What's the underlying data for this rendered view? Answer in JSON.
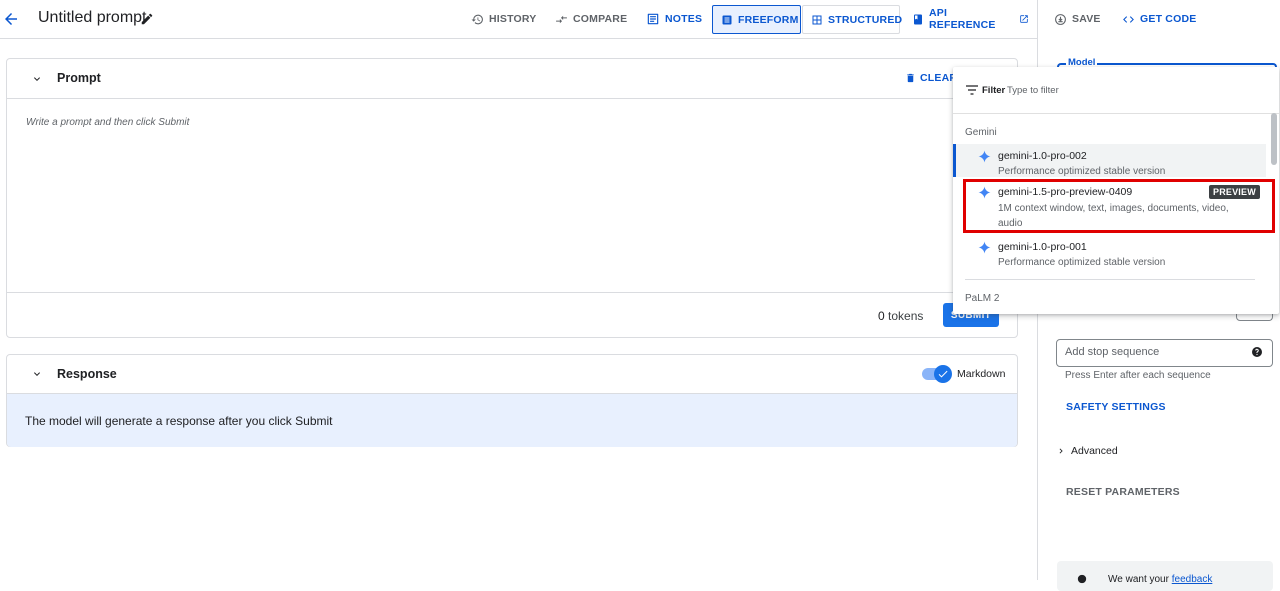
{
  "header": {
    "title": "Untitled prompt",
    "buttons": {
      "history": "HISTORY",
      "compare": "COMPARE",
      "notes": "NOTES",
      "freeform": "FREEFORM",
      "structured": "STRUCTURED",
      "api_reference": "API REFERENCE"
    }
  },
  "right_panel": {
    "save": "SAVE",
    "get_code": "GET CODE",
    "model_label": "Model",
    "stop_sequence_placeholder": "Add stop sequence",
    "stop_sequence_hint": "Press Enter after each sequence",
    "safety_settings": "SAFETY SETTINGS",
    "advanced": "Advanced",
    "reset_parameters": "RESET PARAMETERS",
    "feedback_prefix": "We want your ",
    "feedback_link": "feedback"
  },
  "prompt": {
    "title": "Prompt",
    "clear": "CLEAR",
    "placeholder": "Write a prompt and then click Submit",
    "tokens_count": "0",
    "tokens_label": "tokens",
    "submit": "SUBMIT"
  },
  "response": {
    "title": "Response",
    "markdown_label": "Markdown",
    "markdown_enabled": true,
    "placeholder": "The model will generate a response after you click Submit"
  },
  "model_dropdown": {
    "filter_label": "Filter",
    "filter_placeholder": "Type to filter",
    "groups": [
      {
        "name": "Gemini",
        "options": [
          {
            "name": "gemini-1.0-pro-002",
            "description": "Performance optimized stable version",
            "selected": true
          },
          {
            "name": "gemini-1.5-pro-preview-0409",
            "description": "1M context window, text, images, documents, video, audio",
            "badge": "PREVIEW",
            "highlighted": true
          },
          {
            "name": "gemini-1.0-pro-001",
            "description": "Performance optimized stable version"
          }
        ]
      },
      {
        "name": "PaLM 2",
        "options": []
      }
    ]
  },
  "colors": {
    "accent": "#0b57d0",
    "highlight_border": "#e00000",
    "response_bg": "#e8f0fe"
  }
}
